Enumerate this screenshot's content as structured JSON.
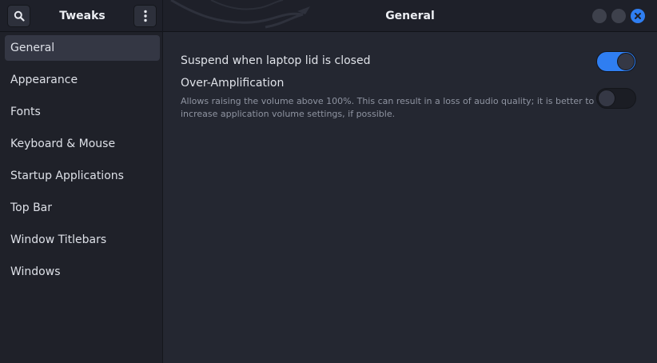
{
  "header": {
    "sidebar_title": "Tweaks",
    "main_title": "General",
    "search_icon": "search-icon",
    "menu_icon": "vertical-dots-icon"
  },
  "window_controls": {
    "close_color": "#2f7ef1",
    "icons": [
      "minimize-icon",
      "maximize-icon",
      "close-icon"
    ]
  },
  "sidebar": {
    "selected_index": 0,
    "items": [
      {
        "label": "General"
      },
      {
        "label": "Appearance"
      },
      {
        "label": "Fonts"
      },
      {
        "label": "Keyboard & Mouse"
      },
      {
        "label": "Startup Applications"
      },
      {
        "label": "Top Bar"
      },
      {
        "label": "Window Titlebars"
      },
      {
        "label": "Windows"
      }
    ]
  },
  "settings": [
    {
      "label": "Suspend when laptop lid is closed",
      "enabled": true
    },
    {
      "label": "Over-Amplification",
      "description": "Allows raising the volume above 100%. This can result in a loss of audio quality; it is better to increase application volume settings, if possible.",
      "enabled": false
    }
  ],
  "colors": {
    "accent": "#2f7ef1",
    "background": "#242731",
    "sidebar": "#1f2129"
  }
}
